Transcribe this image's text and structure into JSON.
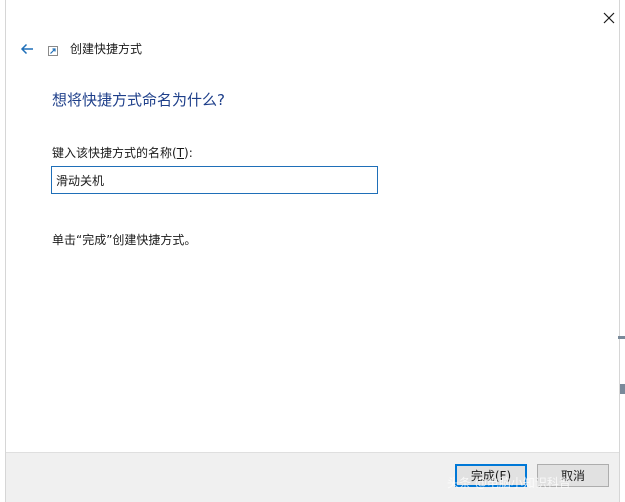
{
  "window": {
    "title": "创建快捷方式"
  },
  "icons": {
    "back": "back-arrow-icon",
    "close": "close-icon",
    "wizard": "shortcut-icon"
  },
  "colors": {
    "heading": "#1e3f8a",
    "back_arrow": "#1f6fb8",
    "input_border": "#1f6fb8",
    "primary_button_border": "#0078d7"
  },
  "page": {
    "heading": "想将快捷方式命名为什么?",
    "field_label_prefix": "键入该快捷方式的名称(",
    "field_label_accesskey": "T",
    "field_label_suffix": "):",
    "field_value": "滑动关机",
    "hint": "单击“完成”创建快捷方式。"
  },
  "footer": {
    "finish_label": "完成(F)",
    "cancel_label": "取消"
  },
  "watermark": "头条 @电脑小知识科普"
}
